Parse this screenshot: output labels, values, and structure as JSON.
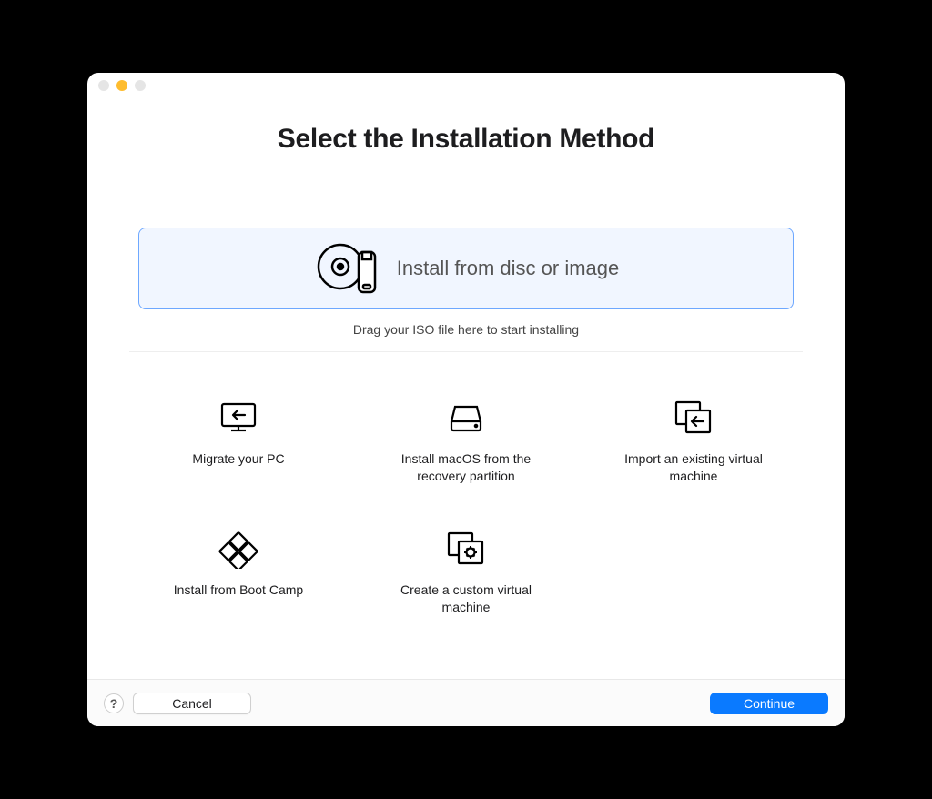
{
  "window": {
    "title": "Select the Installation Method",
    "drag_hint": "Drag your ISO file here to start installing"
  },
  "primary_option": {
    "label": "Install from disc or image",
    "icon": "disc-usb-icon"
  },
  "options": [
    {
      "label": "Migrate your PC",
      "icon": "migrate-pc-icon"
    },
    {
      "label": "Install macOS from the recovery partition",
      "icon": "hard-drive-icon"
    },
    {
      "label": "Import an existing virtual machine",
      "icon": "import-vm-icon"
    },
    {
      "label": "Install from Boot Camp",
      "icon": "boot-camp-icon"
    },
    {
      "label": "Create a custom virtual machine",
      "icon": "custom-vm-icon"
    }
  ],
  "footer": {
    "help_label": "?",
    "cancel_label": "Cancel",
    "continue_label": "Continue"
  },
  "colors": {
    "accent": "#0a7aff",
    "selection_bg": "#f1f6ff",
    "selection_border": "#6ea8ff"
  }
}
